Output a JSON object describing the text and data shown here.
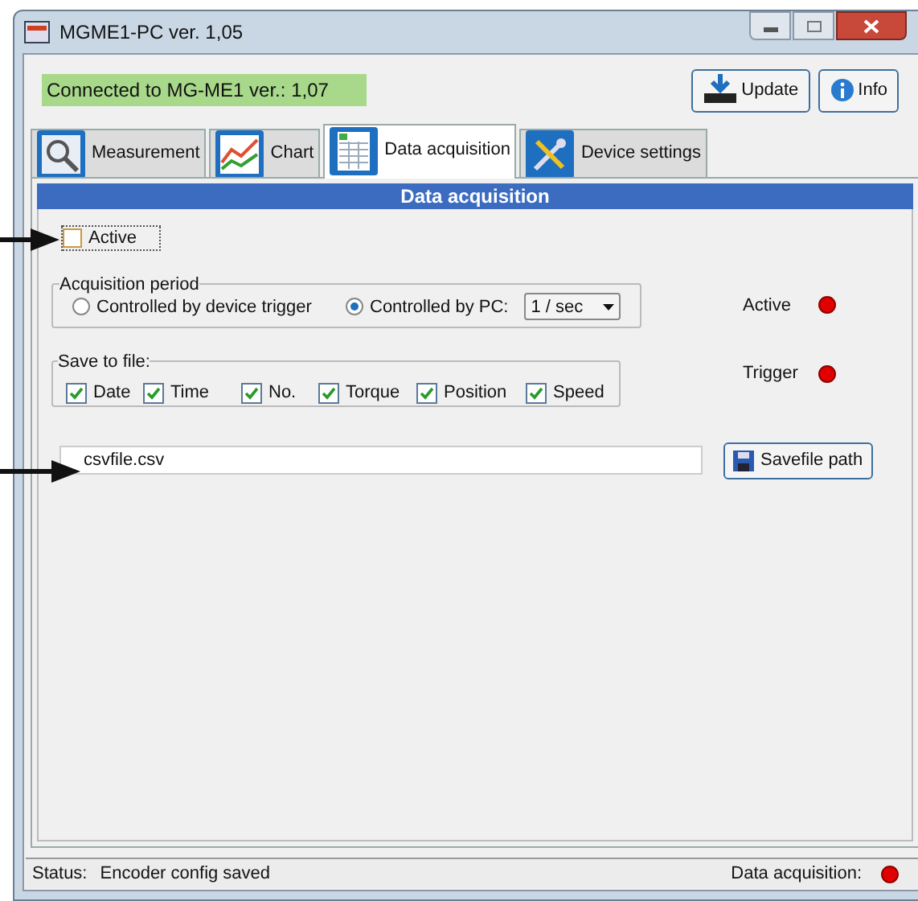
{
  "window": {
    "title": "MGME1-PC ver. 1,05"
  },
  "connection": "Connected to MG-ME1 ver.: 1,07",
  "header_buttons": [
    {
      "label": "Update",
      "kind": "update"
    },
    {
      "label": "Info",
      "kind": "info"
    }
  ],
  "tabs": [
    {
      "label": "Measurement",
      "kind": "measurement",
      "selected": false
    },
    {
      "label": "Chart",
      "kind": "chart",
      "selected": false
    },
    {
      "label": "Data acquisition",
      "kind": "data",
      "selected": true
    },
    {
      "label": "Device settings",
      "kind": "settings",
      "selected": false
    }
  ],
  "panel": {
    "title": "Data acquisition",
    "active_checkbox": {
      "label": "Active",
      "checked": false
    },
    "acquisition_period": {
      "title": "Acquisition period",
      "options": [
        {
          "label": "Controlled by device trigger",
          "selected": false
        },
        {
          "label": "Controlled by PC:",
          "selected": true
        }
      ],
      "rate": "1 / sec"
    },
    "save_to_file": {
      "title": "Save to file:",
      "items": [
        {
          "label": "Date",
          "checked": true
        },
        {
          "label": "Time",
          "checked": true
        },
        {
          "label": "No.",
          "checked": true
        },
        {
          "label": "Torque",
          "checked": true
        },
        {
          "label": "Position",
          "checked": true
        },
        {
          "label": "Speed",
          "checked": true
        }
      ]
    },
    "indicators": [
      {
        "label": "Active",
        "on": false
      },
      {
        "label": "Trigger",
        "on": false
      }
    ],
    "file_path": "csvfile.csv",
    "savefile_button": "Savefile path"
  },
  "status_bar": {
    "label": "Status:",
    "message": "Encoder config saved",
    "acquisition_label": "Data acquisition:",
    "acquisition_on": false
  }
}
